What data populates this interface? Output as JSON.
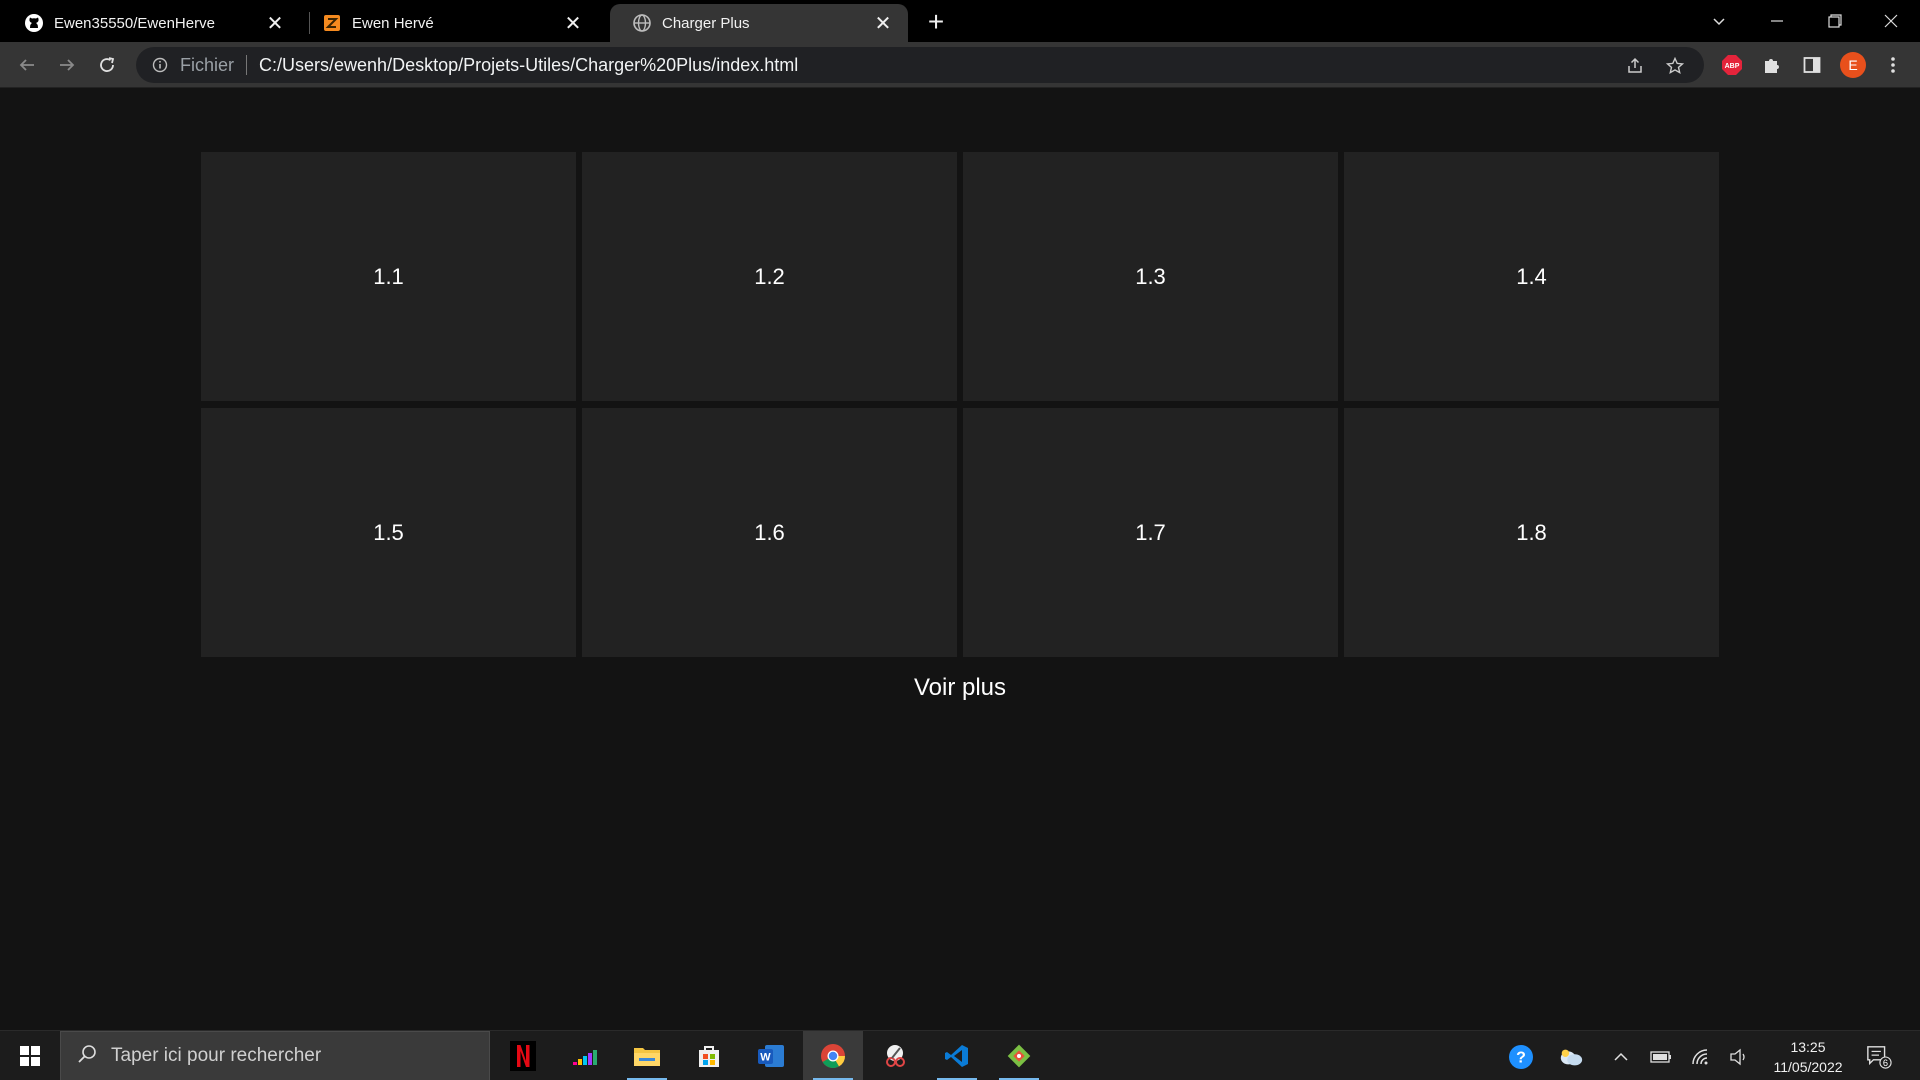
{
  "browser": {
    "tabs": [
      {
        "title": "Ewen35550/EwenHerve",
        "favicon": "github-icon",
        "active": false
      },
      {
        "title": "Ewen Hervé",
        "favicon": "site-logo-icon",
        "active": false
      },
      {
        "title": "Charger Plus",
        "favicon": "globe-icon",
        "active": true
      }
    ],
    "address": {
      "scheme_label": "Fichier",
      "url": "C:/Users/ewenh/Desktop/Projets-Utiles/Charger%20Plus/index.html"
    },
    "profile_initial": "E",
    "extensions": {
      "adblock_label": "ABP"
    }
  },
  "page": {
    "cards": [
      "1.1",
      "1.2",
      "1.3",
      "1.4",
      "1.5",
      "1.6",
      "1.7",
      "1.8"
    ],
    "more_label": "Voir plus"
  },
  "taskbar": {
    "search_placeholder": "Taper ici pour rechercher",
    "apps": [
      "netflix-icon",
      "deezer-icon",
      "file-explorer-icon",
      "store-icon",
      "word-icon",
      "chrome-icon",
      "snip-tool-icon",
      "vscode-icon",
      "git-icon"
    ],
    "time": "13:25",
    "date": "11/05/2022",
    "notification_count": "6"
  },
  "colors": {
    "page_bg": "#131313",
    "card_bg": "#222222",
    "tab_active": "#353535",
    "accent_taskbar": "#76b9ed"
  }
}
